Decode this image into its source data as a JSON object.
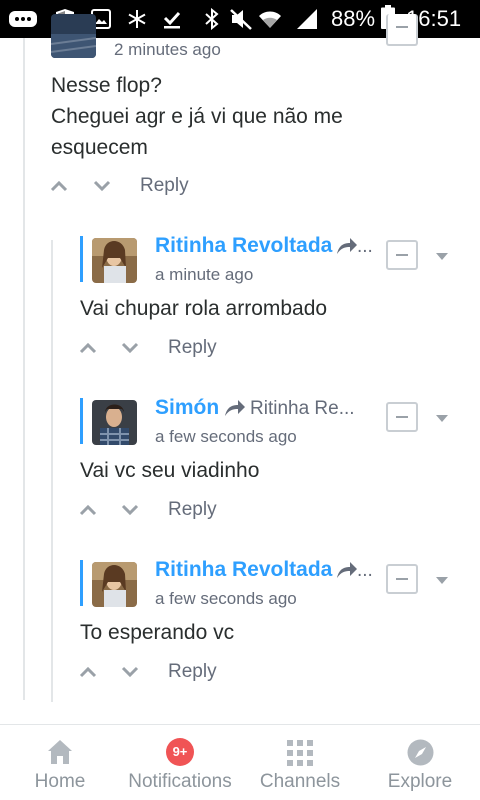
{
  "status_bar": {
    "battery_percent": "88%",
    "time": "16:51"
  },
  "comments": [
    {
      "time": "2 minutes ago",
      "lines": [
        "Nesse flop?",
        "Cheguei agr e já vi que não me",
        "esquecem"
      ],
      "reply_label": "Reply"
    },
    {
      "author": "Ritinha Revoltada",
      "reply_to": "...",
      "time": "a minute ago",
      "text": "Vai chupar rola arrombado",
      "reply_label": "Reply"
    },
    {
      "author": "Simón",
      "reply_to": "Ritinha Re...",
      "time": "a few seconds ago",
      "text": "Vai vc seu viadinho",
      "reply_label": "Reply"
    },
    {
      "author": "Ritinha Revoltada",
      "reply_to": "...",
      "time": "a few seconds ago",
      "text": "To esperando vc",
      "reply_label": "Reply"
    }
  ],
  "bottom_nav": {
    "items": [
      {
        "label": "Home",
        "icon": "home-icon"
      },
      {
        "label": "Notifications",
        "icon": "notifications-icon",
        "badge": "9+"
      },
      {
        "label": "Channels",
        "icon": "channels-icon"
      },
      {
        "label": "Explore",
        "icon": "compass-icon"
      }
    ]
  },
  "colors": {
    "accent": "#2e9fff",
    "text": "#2a2e2e",
    "muted": "#656c7a",
    "badge": "#f05455"
  }
}
